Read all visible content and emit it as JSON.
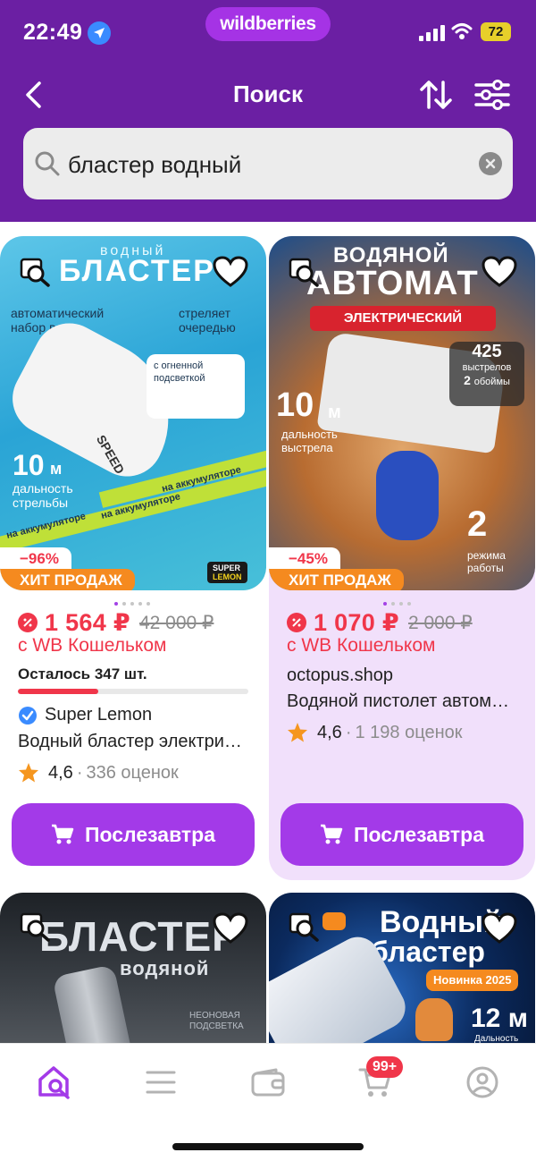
{
  "status_bar": {
    "time": "22:49",
    "battery": "72"
  },
  "brand": "wildberries",
  "header": {
    "title": "Поиск"
  },
  "search": {
    "value": "бластер водный"
  },
  "products": [
    {
      "image_text": {
        "top_small": "водный",
        "top_big": "БЛАСТЕР",
        "feature_1": "автоматический набор воды",
        "feature_2": "стреляет очередью",
        "feature_3": "с огненной подсветкой",
        "range_value": "10",
        "range_unit": "м",
        "range_label": "дальность стрельбы",
        "band_1": "на аккумуляторе",
        "band_2": "на аккумуляторе",
        "band_3": "на аккумуляторе",
        "gun_label": "SPEED",
        "logo_1": "SUPER",
        "logo_2": "LEMON"
      },
      "discount": "−96%",
      "badge": "ХИТ ПРОДАЖ",
      "price": "1 564 ₽",
      "old_price": "42 000 ₽",
      "wallet_text": "с WB Кошельком",
      "stock_text": "Осталось 347 шт.",
      "stock_fraction": 0.35,
      "brand": "Super Lemon",
      "name": "Водный бластер электри…",
      "rating": "4,6",
      "reviews": "336 оценок",
      "delivery": "Послезавтра",
      "favorited": false
    },
    {
      "image_text": {
        "top_1": "ВОДЯНОЙ",
        "top_2": "АВТОМАТ",
        "ribbon": "ЭЛЕКТРИЧЕСКИЙ",
        "range_value": "10",
        "range_unit": "м",
        "range_label": "дальность выстрела",
        "shots_value": "425",
        "shots_label": "выстрелов",
        "clips_value": "2",
        "clips_label": "обоймы",
        "modes_value": "2",
        "modes_label": "режима работы"
      },
      "discount": "−45%",
      "badge": "ХИТ ПРОДАЖ",
      "price": "1 070 ₽",
      "old_price": "2 000 ₽",
      "wallet_text": "с WB Кошельком",
      "shop": "octopus.shop",
      "name": "Водяной пистолет автом…",
      "rating": "4,6",
      "reviews": "1 198 оценок",
      "delivery": "Послезавтра",
      "favorited": false
    }
  ],
  "next_row": [
    {
      "image_title": "БЛАСТЕР",
      "image_subtitle": "водяной",
      "image_note": "НЕОНОВАЯ ПОДСВЕТКА"
    },
    {
      "image_title_1": "Водный",
      "image_title_2": "бластер",
      "image_badge": "Новинка 2025",
      "image_value": "12 м",
      "image_caption": "Дальность"
    }
  ],
  "bottom_nav": {
    "cart_count": "99+"
  },
  "colors": {
    "header": "#6b1fa3",
    "accent": "#a33ae8",
    "price": "#f0364a",
    "badge_orange": "#f58a1f"
  },
  "icons": [
    "back-arrow-icon",
    "sort-icon",
    "filter-icon",
    "search-icon",
    "clear-icon",
    "zoom-icon",
    "heart-icon",
    "star-icon",
    "verified-icon",
    "cart-icon",
    "home-search-icon",
    "menu-icon",
    "wallet-icon",
    "profile-icon"
  ]
}
